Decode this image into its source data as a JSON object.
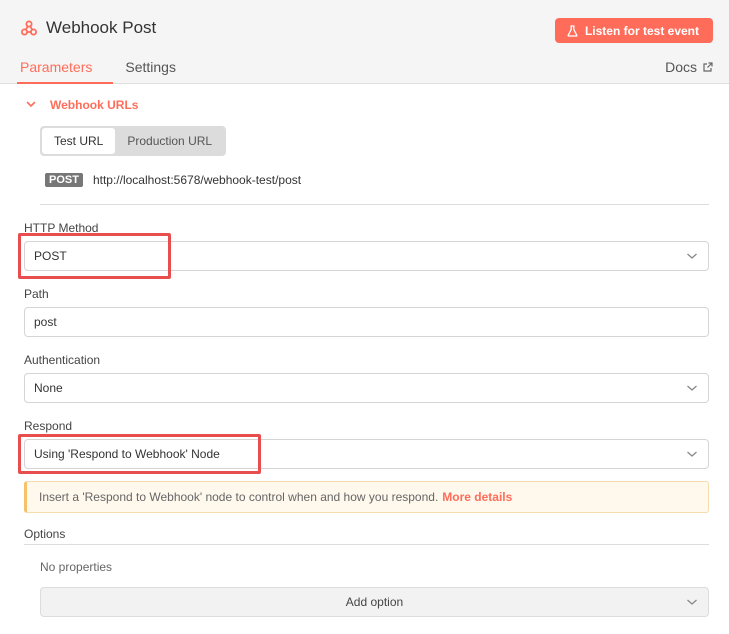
{
  "header": {
    "title": "Webhook Post",
    "listen_button": "Listen for test event",
    "tabs": [
      {
        "label": "Parameters",
        "active": true
      },
      {
        "label": "Settings",
        "active": false
      }
    ],
    "docs_label": "Docs"
  },
  "webhook_urls": {
    "label": "Webhook URLs",
    "options": [
      "Test URL",
      "Production URL"
    ],
    "selected": "Test URL",
    "method": "POST",
    "url": "http://localhost:5678/webhook-test/post"
  },
  "fields": {
    "http_method": {
      "label": "HTTP Method",
      "value": "POST"
    },
    "path": {
      "label": "Path",
      "value": "post"
    },
    "authentication": {
      "label": "Authentication",
      "value": "None"
    },
    "respond": {
      "label": "Respond",
      "value": "Using 'Respond to Webhook' Node"
    }
  },
  "notice": {
    "text": "Insert a 'Respond to Webhook' node to control when and how you respond.",
    "link": "More details"
  },
  "options": {
    "label": "Options",
    "empty_text": "No properties",
    "add_button": "Add option"
  },
  "colors": {
    "accent": "#ff6d5a",
    "highlight": "#e84e4e"
  },
  "icons": {
    "title": "webhook-icon",
    "listen": "flask-icon",
    "docs": "external-link-icon",
    "collapse": "chevron-down-icon",
    "select": "chevron-down-icon"
  }
}
